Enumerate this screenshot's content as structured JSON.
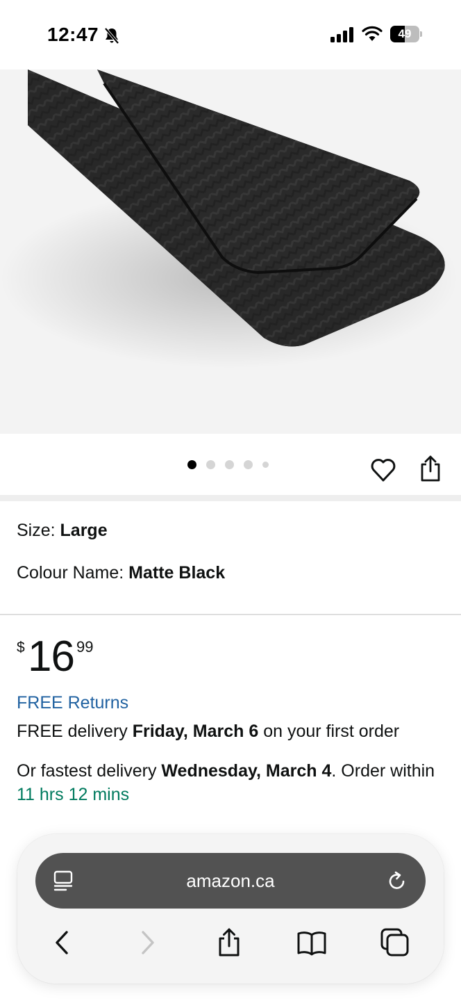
{
  "status_bar": {
    "time": "12:47",
    "battery_level": "49",
    "battery_percent": 49
  },
  "product": {
    "image_alt": "Matte black carbon fiber money clip",
    "carousel": {
      "count": 5,
      "active": 0
    },
    "size_label": "Size: ",
    "size_value": "Large",
    "colour_label": "Colour Name: ",
    "colour_value": "Matte Black"
  },
  "pricing": {
    "currency_symbol": "$",
    "whole": "16",
    "fraction": "99"
  },
  "delivery": {
    "free_returns": "FREE Returns",
    "free_prefix": "FREE delivery ",
    "free_date": "Friday, March 6",
    "free_suffix": " on your first order",
    "fast_prefix": "Or fastest delivery ",
    "fast_date": "Wednesday, March 4",
    "fast_middle": ". Order within ",
    "countdown": "11 hrs 12 mins"
  },
  "browser": {
    "url": "amazon.ca"
  },
  "icons": {
    "bell": "bell-slash-icon",
    "signal": "cellular-signal-icon",
    "wifi": "wifi-icon",
    "heart": "heart-icon",
    "share": "share-icon",
    "reader": "reader-mode-icon",
    "reload": "reload-icon",
    "back": "chevron-left-icon",
    "forward": "chevron-right-icon",
    "bookmarks": "book-icon",
    "tabs": "tabs-icon"
  },
  "colors": {
    "link_blue": "#2162a1",
    "countdown_green": "#007a5e",
    "address_bar": "#525252"
  }
}
